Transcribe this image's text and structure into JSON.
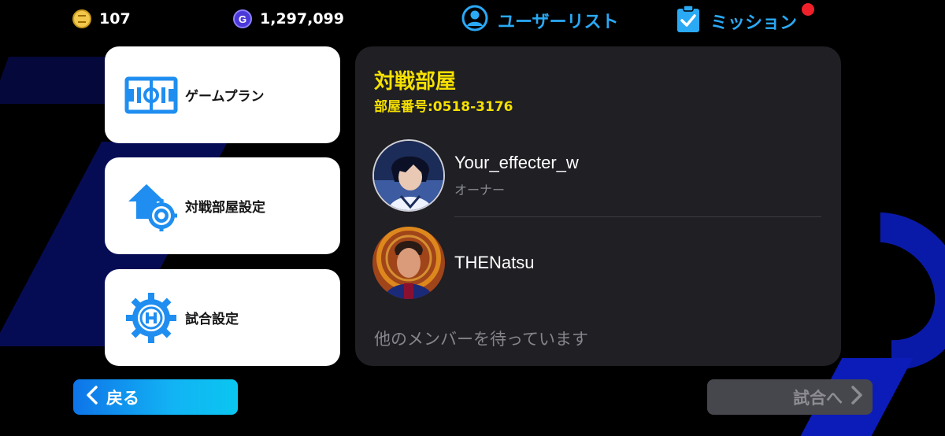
{
  "currency": {
    "coins": "107",
    "gp": "1,297,099",
    "gp_icon_letter": "G"
  },
  "topnav": {
    "user_list": "ユーザーリスト",
    "missions": "ミッション"
  },
  "menu": {
    "items": [
      {
        "label": "ゲームプラン",
        "icon": "game-plan-icon"
      },
      {
        "label": "対戦部屋設定",
        "icon": "room-settings-icon"
      },
      {
        "label": "試合設定",
        "icon": "match-settings-icon"
      }
    ]
  },
  "room": {
    "title": "対戦部屋",
    "number": "部屋番号:0518-3176",
    "members": [
      {
        "name": "Your_effecter_w",
        "role": "オーナー"
      },
      {
        "name": "THENatsu",
        "role": ""
      }
    ],
    "waiting": "他のメンバーを待っています"
  },
  "buttons": {
    "back": "戻る",
    "next": "試合へ"
  },
  "colors": {
    "accent_blue": "#2aa9f5",
    "title_yellow": "#f5e000",
    "notification_red": "#f0202b"
  }
}
